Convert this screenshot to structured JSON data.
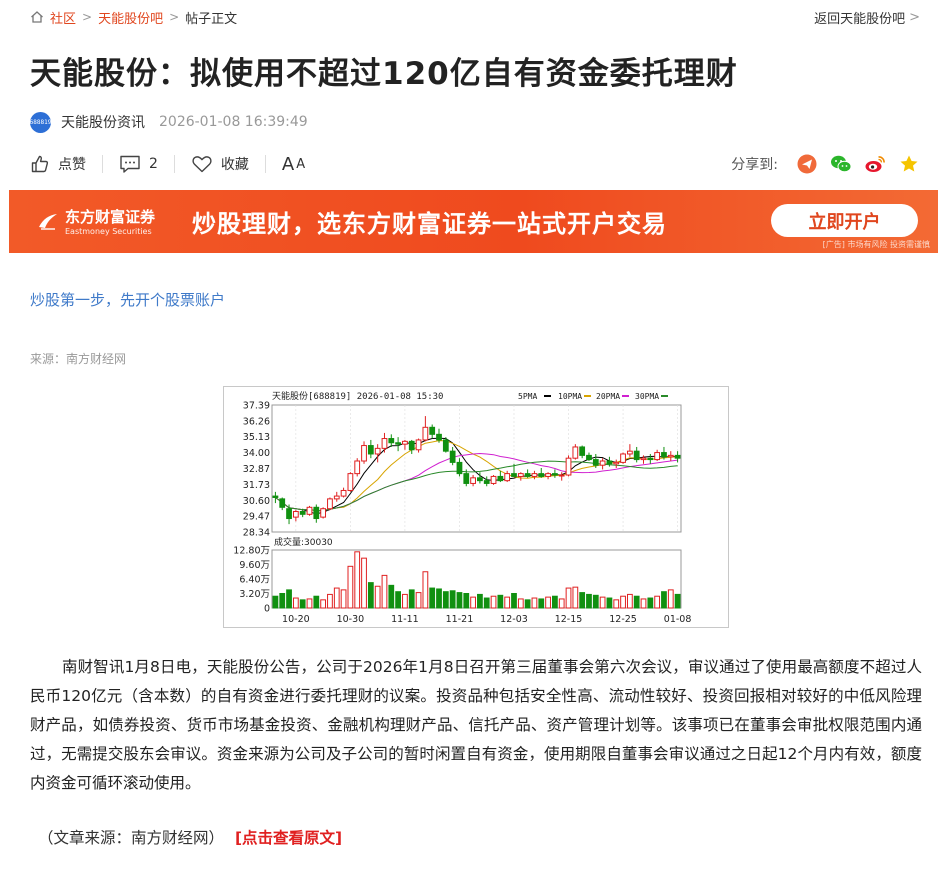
{
  "breadcrumb": {
    "home": "社区",
    "forum": "天能股份吧",
    "current": "帖子正文",
    "back": "返回天能股份吧"
  },
  "post": {
    "title": "天能股份：拟使用不超过120亿自有资金委托理财",
    "avatar_text": "688819",
    "author": "天能股份资讯",
    "time": "2026-01-08 16:39:49"
  },
  "actions": {
    "like": "点赞",
    "comment_count": "2",
    "favorite": "收藏",
    "font_big": "A",
    "font_small": "A",
    "share_label": "分享到:"
  },
  "banner": {
    "brand_cn": "东方财富证券",
    "brand_en": "Eastmoney Securities",
    "slogan": "炒股理财，选东方财富证券一站式开户交易",
    "button": "立即开户",
    "ad_note": "[广告] 市场有风险 投资需谨慎"
  },
  "promo_link": "炒股第一步，先开个股票账户",
  "source": "来源：南方财经网",
  "chart_data": {
    "type": "candlestick",
    "title": "天能股份[688819] 2026-01-08 15:30",
    "legend": [
      "5PMA",
      "10PMA",
      "20PMA",
      "30PMA"
    ],
    "ma_colors": [
      "#000000",
      "#d8a400",
      "#d020d0",
      "#2a8a2a"
    ],
    "up_color": "#e02020",
    "down_color": "#109010",
    "price_ticks": [
      "37.39",
      "36.26",
      "35.13",
      "34.00",
      "32.87",
      "31.73",
      "30.60",
      "29.47",
      "28.34"
    ],
    "price_range": [
      28.34,
      37.39
    ],
    "volume_title": "成交量:30030",
    "volume_ticks": [
      "12.80万",
      "9.60万",
      "6.40万",
      "3.20万",
      "0"
    ],
    "volume_range": [
      0,
      128000
    ],
    "date_ticks": [
      {
        "label": "10-20",
        "index": 3
      },
      {
        "label": "10-30",
        "index": 11
      },
      {
        "label": "11-11",
        "index": 19
      },
      {
        "label": "11-21",
        "index": 27
      },
      {
        "label": "12-03",
        "index": 35
      },
      {
        "label": "12-15",
        "index": 43
      },
      {
        "label": "12-25",
        "index": 51
      },
      {
        "label": "01-08",
        "index": 59
      }
    ],
    "candles": [
      [
        30.9,
        31.2,
        30.4,
        30.8,
        26000
      ],
      [
        30.7,
        30.8,
        29.9,
        30.1,
        32000
      ],
      [
        30.0,
        30.3,
        28.9,
        29.3,
        40000
      ],
      [
        29.4,
        29.9,
        29.1,
        29.8,
        22000
      ],
      [
        29.8,
        30.0,
        29.4,
        29.6,
        18000
      ],
      [
        29.6,
        30.2,
        29.5,
        30.1,
        20000
      ],
      [
        30.1,
        30.3,
        29.0,
        29.3,
        26000
      ],
      [
        29.4,
        30.1,
        29.3,
        30.0,
        18000
      ],
      [
        30.0,
        30.8,
        29.9,
        30.7,
        30000
      ],
      [
        30.7,
        31.2,
        30.5,
        30.9,
        44000
      ],
      [
        30.9,
        31.5,
        30.8,
        31.3,
        40000
      ],
      [
        31.3,
        32.6,
        31.2,
        32.5,
        92000
      ],
      [
        32.5,
        33.6,
        32.3,
        33.4,
        124000
      ],
      [
        33.4,
        34.8,
        33.2,
        34.5,
        110000
      ],
      [
        34.5,
        34.9,
        33.6,
        33.9,
        56000
      ],
      [
        33.9,
        34.6,
        33.3,
        34.3,
        48000
      ],
      [
        34.3,
        35.4,
        34.0,
        35.0,
        72000
      ],
      [
        35.0,
        35.3,
        34.4,
        34.7,
        50000
      ],
      [
        34.7,
        35.1,
        34.1,
        34.6,
        36000
      ],
      [
        34.6,
        34.9,
        34.2,
        34.8,
        30000
      ],
      [
        34.8,
        34.9,
        33.9,
        34.2,
        40000
      ],
      [
        34.2,
        35.0,
        34.0,
        34.9,
        34000
      ],
      [
        34.9,
        36.6,
        34.8,
        35.8,
        80000
      ],
      [
        35.8,
        36.0,
        35.0,
        35.3,
        44000
      ],
      [
        35.3,
        35.7,
        34.7,
        34.9,
        42000
      ],
      [
        34.9,
        35.1,
        34.0,
        34.1,
        36000
      ],
      [
        34.1,
        34.4,
        33.1,
        33.3,
        38000
      ],
      [
        33.3,
        33.6,
        32.3,
        32.5,
        34000
      ],
      [
        32.5,
        32.8,
        31.6,
        31.8,
        32000
      ],
      [
        31.8,
        32.4,
        31.6,
        32.2,
        24000
      ],
      [
        32.2,
        32.6,
        31.8,
        32.0,
        30000
      ],
      [
        32.0,
        32.3,
        31.6,
        31.8,
        22000
      ],
      [
        31.8,
        32.4,
        31.7,
        32.3,
        26000
      ],
      [
        32.3,
        32.7,
        31.9,
        32.0,
        28000
      ],
      [
        32.0,
        32.7,
        31.9,
        32.5,
        24000
      ],
      [
        32.5,
        33.2,
        32.4,
        32.3,
        32000
      ],
      [
        32.3,
        32.6,
        32.0,
        32.5,
        20000
      ],
      [
        32.5,
        32.8,
        32.2,
        32.3,
        18000
      ],
      [
        32.3,
        32.7,
        32.1,
        32.5,
        22000
      ],
      [
        32.5,
        32.9,
        32.2,
        32.3,
        20000
      ],
      [
        32.3,
        32.6,
        32.1,
        32.5,
        24000
      ],
      [
        32.5,
        32.8,
        32.2,
        32.4,
        26000
      ],
      [
        32.4,
        32.6,
        32.0,
        32.4,
        20000
      ],
      [
        32.4,
        33.8,
        32.3,
        33.6,
        44000
      ],
      [
        33.6,
        34.6,
        33.5,
        34.4,
        46000
      ],
      [
        34.4,
        34.5,
        33.6,
        33.8,
        34000
      ],
      [
        33.8,
        34.0,
        33.4,
        33.5,
        30000
      ],
      [
        33.5,
        33.9,
        32.9,
        33.1,
        28000
      ],
      [
        33.1,
        33.6,
        32.8,
        33.4,
        24000
      ],
      [
        33.4,
        33.7,
        33.0,
        33.2,
        22000
      ],
      [
        33.2,
        33.5,
        32.9,
        33.3,
        18000
      ],
      [
        33.3,
        34.0,
        33.2,
        33.9,
        26000
      ],
      [
        33.9,
        34.6,
        33.7,
        34.1,
        30000
      ],
      [
        34.1,
        34.4,
        33.3,
        33.5,
        26000
      ],
      [
        33.5,
        33.8,
        33.2,
        33.6,
        20000
      ],
      [
        33.6,
        33.9,
        33.2,
        33.5,
        22000
      ],
      [
        33.5,
        34.2,
        33.4,
        34.0,
        26000
      ],
      [
        34.0,
        34.4,
        33.5,
        33.7,
        36000
      ],
      [
        33.7,
        34.1,
        33.4,
        33.8,
        40000
      ],
      [
        33.8,
        34.1,
        33.3,
        33.6,
        30030
      ]
    ]
  },
  "article": {
    "body": "南财智讯1月8日电，天能股份公告，公司于2026年1月8日召开第三届董事会第六次会议，审议通过了使用最高额度不超过人民币120亿元（含本数）的自有资金进行委托理财的议案。投资品种包括安全性高、流动性较好、投资回报相对较好的中低风险理财产品，如债券投资、货币市场基金投资、金融机构理财产品、信托产品、资产管理计划等。该事项已在董事会审批权限范围内通过，无需提交股东会审议。资金来源为公司及子公司的暂时闲置自有资金，使用期限自董事会审议通过之日起12个月内有效，额度内资金可循环滚动使用。",
    "footnote": "（文章来源：南方财经网）",
    "origin_link": "[点击查看原文]"
  }
}
